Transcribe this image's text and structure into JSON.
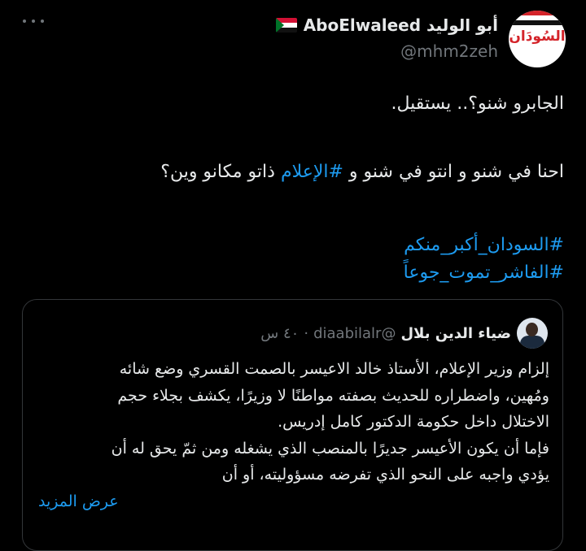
{
  "tweet": {
    "display_name": "AboElwaleed أبو الوليد",
    "handle": "@mhm2zeh",
    "avatar_text": "السُودَان",
    "body": {
      "line1": "الجابرو شنو؟..  يستقيل.",
      "line2_before": "احنا في شنو و انتو في شنو و ",
      "line2_hashtag": "#الإعلام",
      "line2_after": " ذاتو مكانو وين؟",
      "hashtag1": "#السودان_أكبر_منكم",
      "hashtag2": "#الفاشر_تموت_جوعاً"
    },
    "more_icon": "more-horizontal-icon",
    "flag_icon": "sudan-flag-icon",
    "colors": {
      "accent": "#1d9bf0",
      "text": "#e7e9ea",
      "muted": "#71767b",
      "border": "#333639"
    }
  },
  "quote": {
    "display_name": "ضياء الدين بلال",
    "handle": "@diaabilalr",
    "separator": "·",
    "time": "٤٠ س",
    "lines": [
      "إلزام وزير الإعلام، الأستاذ خالد الاعيسر بالصمت القسري وضع شائه",
      "ومُهين، واضطراره للحديث بصفته مواطنًا لا وزيرًا، يكشف بجلاء حجم",
      "الاختلال داخل حكومة الدكتور كامل إدريس.",
      "فإما أن يكون الأعيسر جديرًا بالمنصب الذي يشغله ومن ثمّ يحق له أن",
      "يؤدي واجبه على النحو الذي تفرضه مسؤوليته، أو أن"
    ],
    "show_more": "عرض المزيد"
  }
}
